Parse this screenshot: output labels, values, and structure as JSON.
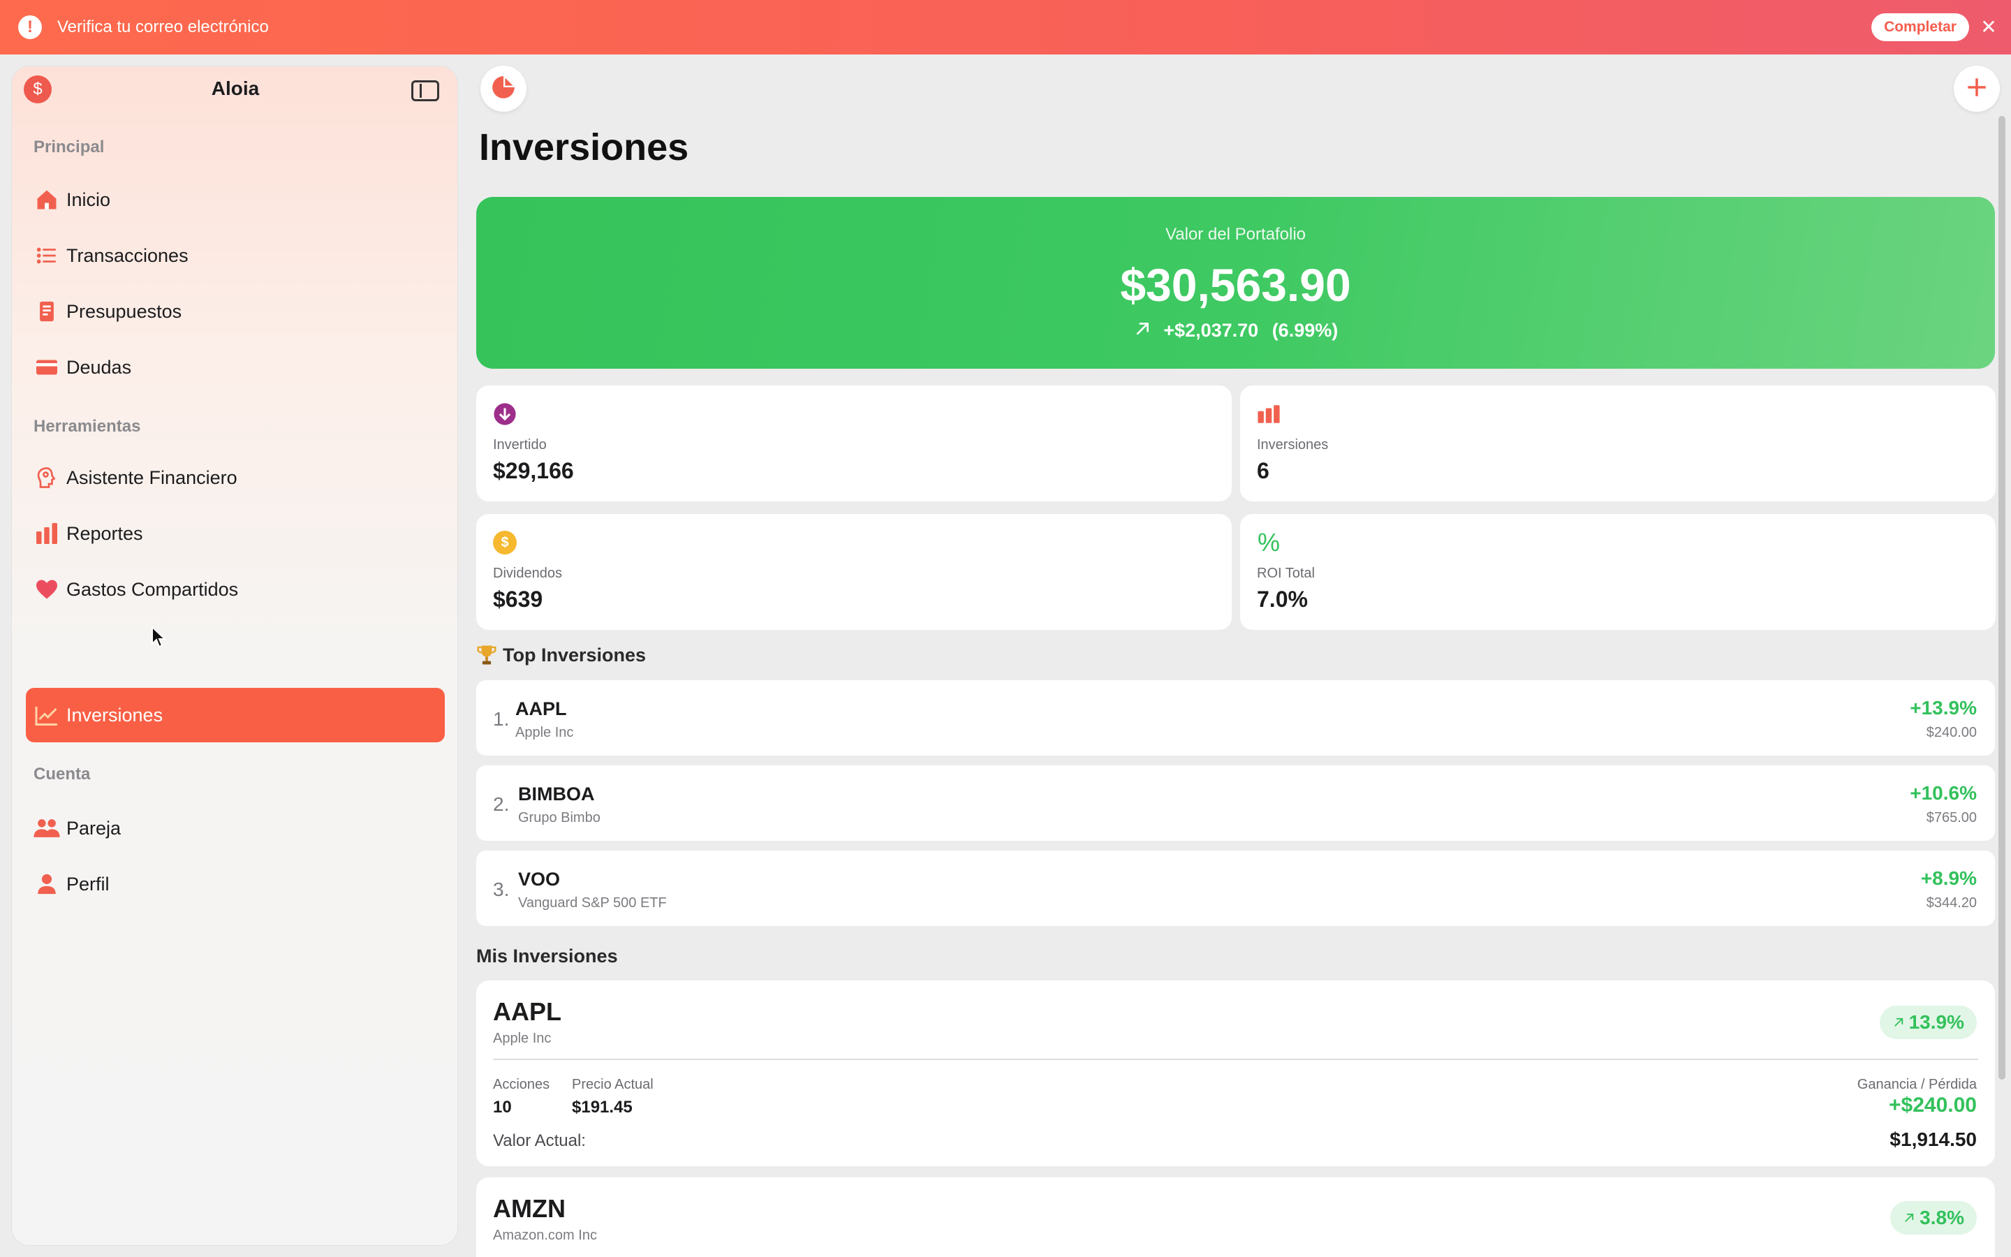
{
  "banner": {
    "message": "Verifica tu correo electrónico",
    "action_label": "Completar",
    "close_glyph": "✕",
    "warn_glyph": "!"
  },
  "sidebar": {
    "logo_glyph": "$",
    "title": "Aloia",
    "sections": {
      "principal": "Principal",
      "herramientas": "Herramientas",
      "cuenta": "Cuenta"
    },
    "items": [
      {
        "label": "Inicio",
        "icon": "house-icon"
      },
      {
        "label": "Transacciones",
        "icon": "list-icon"
      },
      {
        "label": "Presupuestos",
        "icon": "document-icon"
      },
      {
        "label": "Deudas",
        "icon": "credit-card-icon"
      },
      {
        "label": "Asistente Financiero",
        "icon": "brain-head-icon"
      },
      {
        "label": "Reportes",
        "icon": "bar-chart-icon"
      },
      {
        "label": "Gastos Compartidos",
        "icon": "heart-icon"
      },
      {
        "label": "Inversiones",
        "icon": "trend-chart-icon",
        "active": true
      },
      {
        "label": "Pareja",
        "icon": "people-icon"
      },
      {
        "label": "Perfil",
        "icon": "person-icon"
      }
    ]
  },
  "main": {
    "title": "Inversiones",
    "portfolio": {
      "label": "Valor del Portafolio",
      "value": "$30,563.90",
      "change": "+$2,037.70",
      "change_pct": "(6.99%)"
    },
    "stats": [
      {
        "label": "Invertido",
        "value": "$29,166",
        "icon": "download-circle-icon"
      },
      {
        "label": "Inversiones",
        "value": "6",
        "icon": "bar-chart-icon"
      },
      {
        "label": "Dividendos",
        "value": "$639",
        "icon": "dollar-coin-icon",
        "glyph": "$"
      },
      {
        "label": "ROI Total",
        "value": "7.0%",
        "icon": "percent-icon",
        "glyph": "%"
      }
    ],
    "top_title": "Top Inversiones",
    "top": [
      {
        "rank": "1.",
        "ticker": "AAPL",
        "name": "Apple Inc",
        "pct": "+13.9%",
        "amount": "$240.00"
      },
      {
        "rank": "2.",
        "ticker": "BIMBOA",
        "name": "Grupo Bimbo",
        "pct": "+10.6%",
        "amount": "$765.00"
      },
      {
        "rank": "3.",
        "ticker": "VOO",
        "name": "Vanguard S&P 500 ETF",
        "pct": "+8.9%",
        "amount": "$344.20"
      }
    ],
    "mine_title": "Mis Inversiones",
    "mine": [
      {
        "ticker": "AAPL",
        "name": "Apple Inc",
        "badge": "13.9%",
        "shares_label": "Acciones",
        "shares": "10",
        "price_label": "Precio Actual",
        "price": "$191.45",
        "gain_label": "Ganancia / Pérdida",
        "gain": "+$240.00",
        "value_label": "Valor Actual:",
        "value": "$1,914.50"
      },
      {
        "ticker": "AMZN",
        "name": "Amazon.com Inc",
        "badge": "3.8%"
      }
    ]
  },
  "colors": {
    "accent": "#f95f45",
    "positive": "#33c15c",
    "hero_green": "#35c35a"
  }
}
